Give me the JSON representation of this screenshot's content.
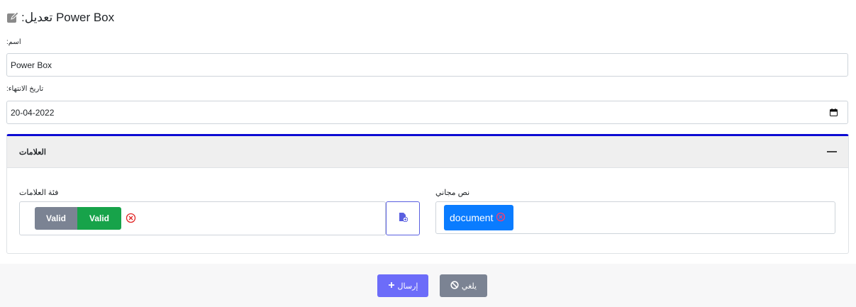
{
  "header": {
    "prefix": ":تعديل",
    "name": "Power Box",
    "icon": "edit-icon"
  },
  "form": {
    "name_label": ":اسم",
    "name_value": "Power Box",
    "expiry_label": ":تاريخ الانتهاء",
    "expiry_value": "20-04-2022"
  },
  "tags_section": {
    "title": "العلامات",
    "category_label": "فئة العلامات",
    "category_tags": [
      "Valid",
      "Valid"
    ],
    "free_text_label": "نص مجاني",
    "free_text_tags": [
      "document"
    ]
  },
  "footer": {
    "send_label": "إرسال",
    "cancel_label": "يلغي"
  },
  "colors": {
    "accent_border": "#0c0bd3",
    "primary": "#6c6cf9",
    "tag_grey": "#7b8393",
    "tag_green": "#17a34a",
    "tag_blue": "#0a7cff",
    "remove_red": "#e02424"
  }
}
